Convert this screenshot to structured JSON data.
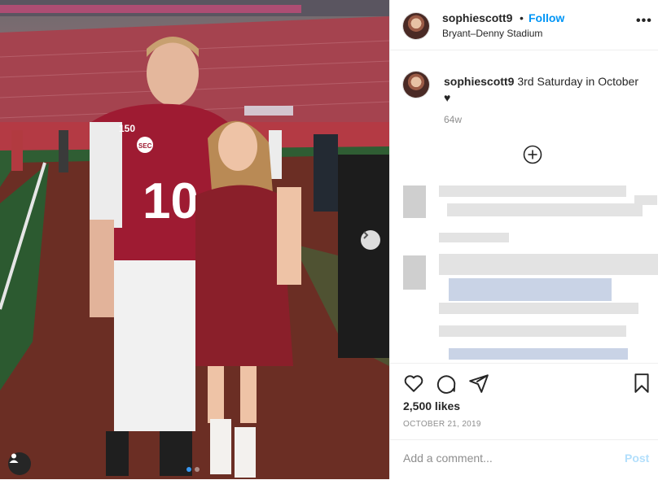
{
  "post": {
    "username": "sophiescott9",
    "separator": "•",
    "follow_label": "Follow",
    "location": "Bryant–Denny Stadium",
    "more_icon": "more-horizontal-icon",
    "caption_username": "sophiescott9",
    "caption_text": "3rd Saturday in October",
    "caption_emoji": "♥",
    "time_ago": "64w",
    "likes": "2,500 likes",
    "date": "OCTOBER 21, 2019"
  },
  "photo": {
    "jersey_number": "10",
    "patch": "150",
    "conference": "SEC",
    "carousel_count": 2,
    "carousel_active": 0
  },
  "comment": {
    "placeholder": "Add a comment...",
    "post_label": "Post"
  },
  "colors": {
    "follow": "#0095f6",
    "post_disabled": "#b2dffc",
    "crimson": "#9e1b32"
  }
}
